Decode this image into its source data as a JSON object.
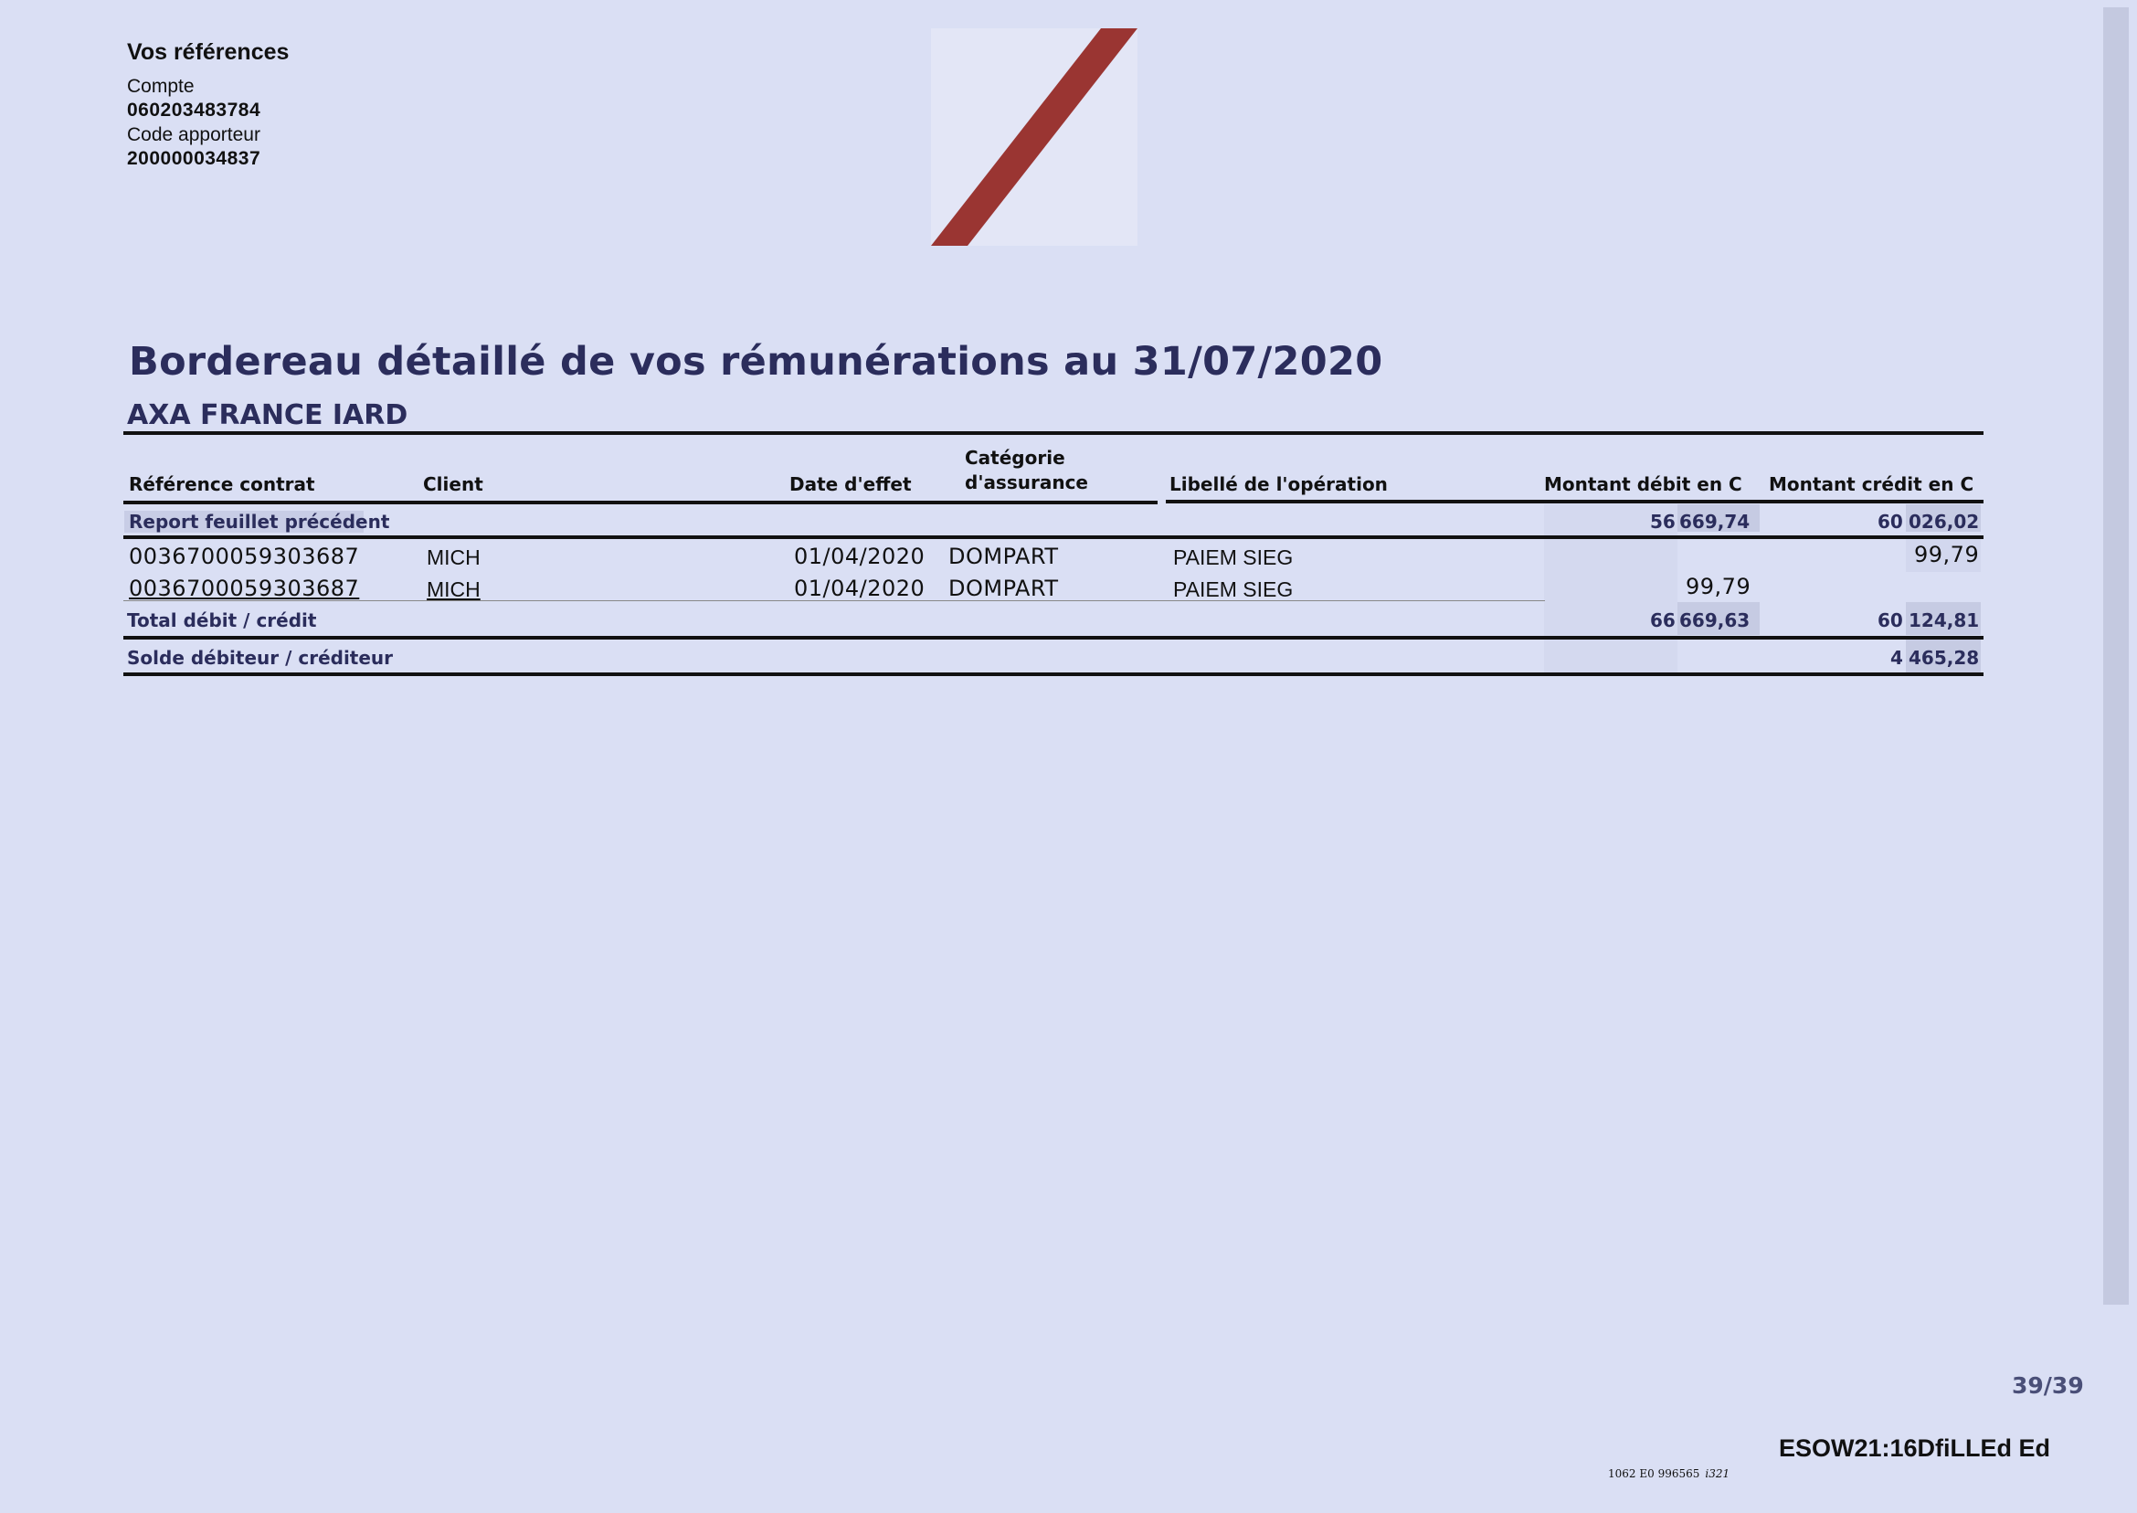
{
  "references": {
    "title": "Vos références",
    "account_label": "Compte",
    "account_value": "060203483784",
    "agent_label": "Code apporteur",
    "agent_value": "200000034837"
  },
  "document": {
    "title": "Bordereau détaillé de vos rémunérations au 31/07/2020",
    "company": "AXA FRANCE IARD"
  },
  "table": {
    "headers": {
      "ref": "Référence contrat",
      "client": "Client",
      "date": "Date d'effet",
      "category_1": "Catégorie",
      "category_2": "d'assurance",
      "label": "Libellé de l'opération",
      "debit": "Montant débit en C",
      "credit": "Montant crédit en C"
    },
    "carry_over": {
      "label": "Report feuillet précédent",
      "debit_a": "56",
      "debit_b": "669,74",
      "credit_a": "60",
      "credit_b": "026,02"
    },
    "rows": [
      {
        "ref": "0036700059303687",
        "client": "MICH",
        "date": "01/04/2020",
        "category": "DOMPART",
        "label": "PAIEM SIEG",
        "debit": "",
        "credit": "99,79"
      },
      {
        "ref": "0036700059303687",
        "client": "MICH",
        "date": "01/04/2020",
        "category": "DOMPART",
        "label": "PAIEM SIEG",
        "debit": "99,79",
        "credit": ""
      }
    ],
    "total": {
      "label": "Total débit / crédit",
      "debit_a": "66",
      "debit_b": "669,63",
      "credit_a": "60",
      "credit_b": "124,81"
    },
    "balance": {
      "label": "Solde débiteur / créditeur",
      "credit_a": "4",
      "credit_b": "465,28"
    }
  },
  "footer": {
    "page": "39/39",
    "code": "ESOW21:16DfiLLEd Ed",
    "tiny_code": "1062 E0 996565",
    "tiny_italic": "i321"
  },
  "colors": {
    "background": "#dadff4",
    "navy": "#2b2d5c",
    "logo_stripe": "#9a3532"
  }
}
